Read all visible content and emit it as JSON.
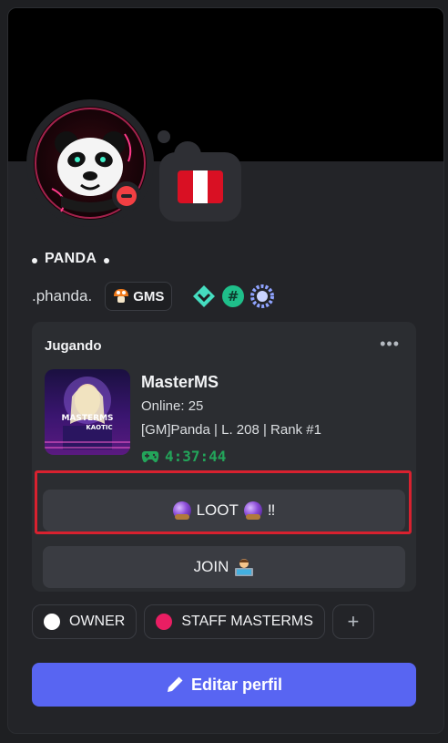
{
  "profile": {
    "display_name": "PANDA",
    "username": ".phanda.",
    "server_tag": "GMS",
    "status": "dnd",
    "flag_colors": [
      "#d91023",
      "#ffffff",
      "#d91023"
    ],
    "badges": [
      "hypesquad-balance-icon",
      "hashtag-badge-icon",
      "nitro-laurel-icon"
    ]
  },
  "activity": {
    "header": "Jugando",
    "more_label": "•••",
    "game_title": "MasterMS",
    "game_image_text": [
      "MASTERMS",
      "KAOTIC"
    ],
    "online_line": "Online: 25",
    "detail_line": "[GM]Panda | L. 208 | Rank #1",
    "elapsed": "4:37:44",
    "buttons": {
      "loot": "LOOT",
      "loot_suffix": "‼",
      "join": "JOIN"
    }
  },
  "roles": [
    {
      "label": "OWNER",
      "color": "#ffffff"
    },
    {
      "label": "STAFF MASTERMS",
      "color": "#e91e63"
    }
  ],
  "add_role_label": "+",
  "edit_button": "Editar perfil",
  "colors": {
    "accent": "#5865f2",
    "timer": "#23a55a",
    "dnd": "#f23f43",
    "highlight": "#d8212f"
  }
}
